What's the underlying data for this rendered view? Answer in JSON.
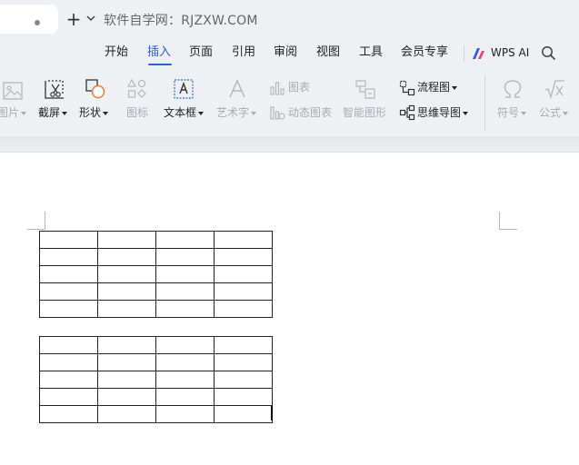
{
  "titlebar": {
    "site_title": "软件自学网：RJZXW.COM"
  },
  "menu": {
    "tabs": [
      {
        "label": "开始",
        "active": false
      },
      {
        "label": "插入",
        "active": true
      },
      {
        "label": "页面",
        "active": false
      },
      {
        "label": "引用",
        "active": false
      },
      {
        "label": "审阅",
        "active": false
      },
      {
        "label": "视图",
        "active": false
      },
      {
        "label": "工具",
        "active": false
      },
      {
        "label": "会员专享",
        "active": false
      }
    ],
    "wps_ai_label": "WPS AI",
    "accent_color": "#2c63d9"
  },
  "ribbon": {
    "picture": "图片",
    "screenshot": "截屏",
    "shape": "形状",
    "icon": "图标",
    "textbox": "文本框",
    "wordart": "艺术字",
    "chart": "图表",
    "dynamic_chart": "动态图表",
    "smart_graphic": "智能图形",
    "flowchart": "流程图",
    "mindmap": "思维导图",
    "symbol": "符号",
    "formula": "公式"
  },
  "document": {
    "tables": [
      {
        "rows": 5,
        "cols": 4
      },
      {
        "rows": 5,
        "cols": 4
      }
    ]
  }
}
